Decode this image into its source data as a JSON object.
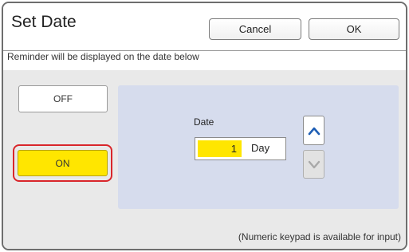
{
  "dialog": {
    "title": "Set Date",
    "cancel_label": "Cancel",
    "ok_label": "OK",
    "subtitle": "Reminder will be displayed on the date below"
  },
  "toggle": {
    "off_label": "OFF",
    "on_label": "ON",
    "selected": "ON",
    "selected_color": "#ffe600",
    "highlight_color": "#d9262b"
  },
  "date": {
    "label": "Date",
    "value": "1",
    "unit": "Day",
    "up_icon": "chevron-up-icon",
    "down_icon": "chevron-down-icon",
    "down_disabled": true
  },
  "footer": {
    "hint": "(Numeric keypad is available for input)"
  }
}
